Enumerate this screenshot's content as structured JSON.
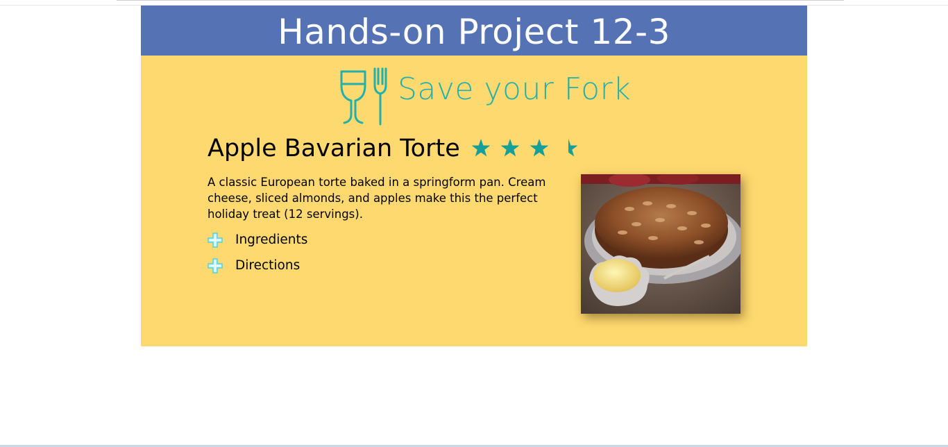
{
  "banner": {
    "title": "Hands-on Project 12-3"
  },
  "logo": {
    "text": "Save your Fork",
    "icon": "glass-fork-logo-icon"
  },
  "recipe": {
    "title": "Apple Bavarian Torte",
    "rating": 3.5,
    "rating_max": 4,
    "description": "A classic European torte baked in a springform pan. Cream cheese, sliced almonds, and apples make this the perfect holiday treat (12 servings).",
    "sections": [
      {
        "label": "Ingredients",
        "icon": "plus-icon"
      },
      {
        "label": "Directions",
        "icon": "plus-icon"
      }
    ],
    "photo": {
      "subject": "torte-photo"
    }
  },
  "colors": {
    "banner": "#5472b4",
    "page": "#fed96f",
    "accent": "#23b0aa",
    "star": "#149f9a"
  }
}
